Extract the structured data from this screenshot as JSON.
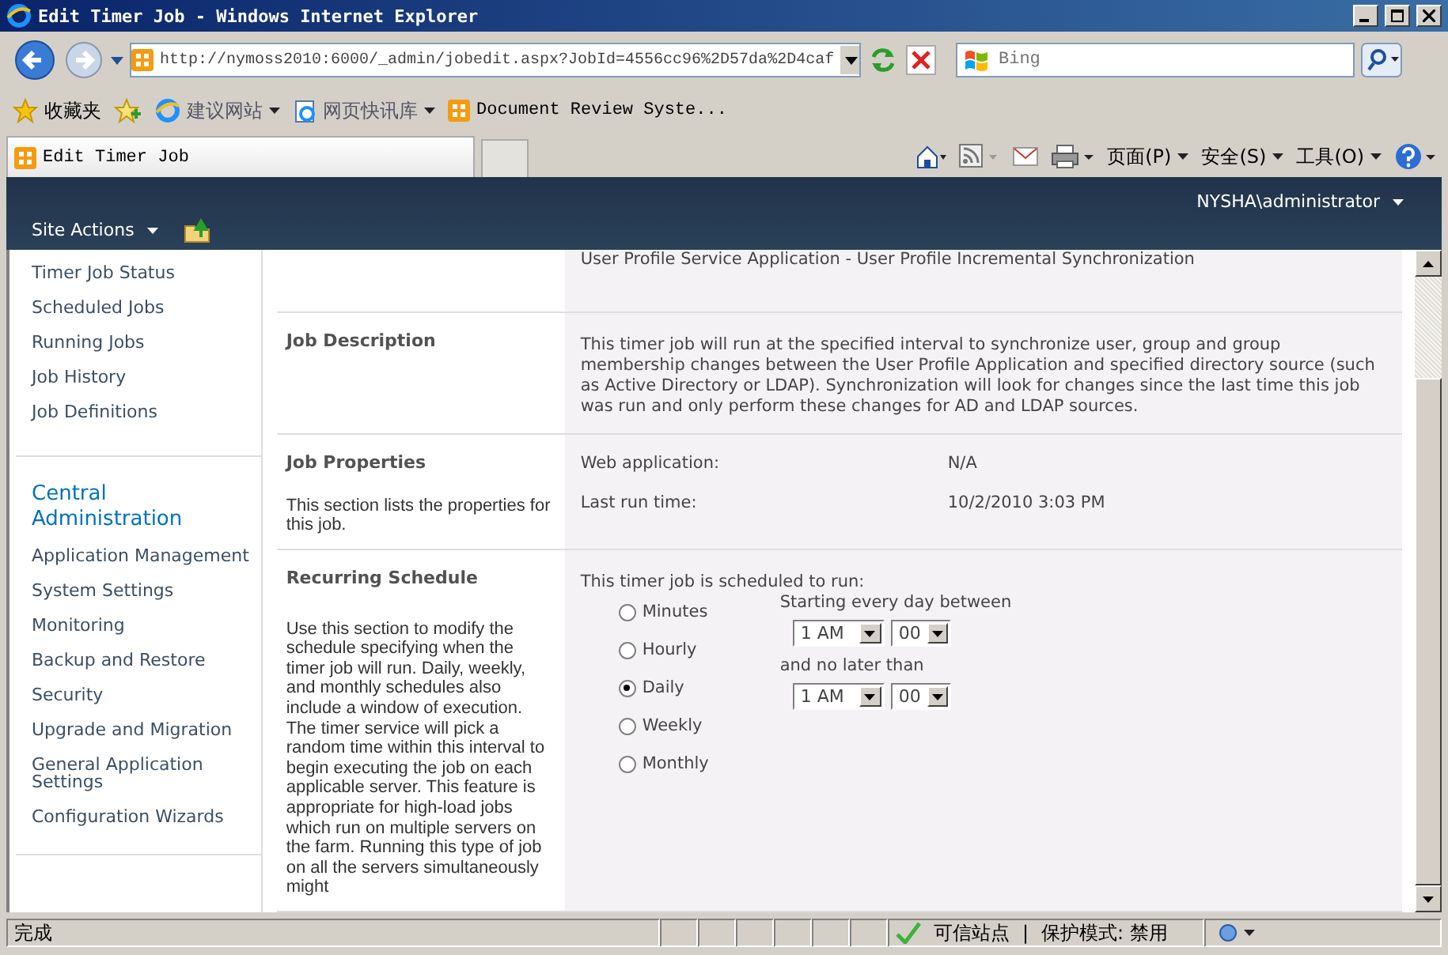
{
  "browser": {
    "title": "Edit Timer Job - Windows Internet Explorer",
    "address": "http://nymoss2010:6000/_admin/jobedit.aspx?JobId=4556cc96%2D57da%2D4caf",
    "search_placeholder": "Bing",
    "favorites_label": "收藏夹",
    "favorites": [
      {
        "label": "建议网站",
        "dropdown": true
      },
      {
        "label": "网页快讯库",
        "dropdown": true
      },
      {
        "label": "Document Review Syste...",
        "dropdown": false
      }
    ],
    "tabs": [
      {
        "label": "Edit Timer Job",
        "selected": true
      }
    ],
    "commands": [
      "页面(P)",
      "安全(S)",
      "工具(O)"
    ]
  },
  "site": {
    "site_actions": "Site Actions",
    "user": "NYSHA\\administrator"
  },
  "nav": {
    "items": [
      "Timer Job Status",
      "Scheduled Jobs",
      "Running Jobs",
      "Job History",
      "Job Definitions"
    ],
    "heading": "Central Administration",
    "admin_items": [
      "Application Management",
      "System Settings",
      "Monitoring",
      "Backup and Restore",
      "Security",
      "Upgrade and Migration",
      "General Application Settings",
      "Configuration Wizards"
    ]
  },
  "sections": [
    {
      "kind": "text",
      "text": "User Profile Service Application - User Profile Incremental Synchronization"
    },
    {
      "kind": "text",
      "title": "Job Description",
      "text": "This timer job will run at the specified interval to synchronize user, group and group membership changes between the User Profile Application and specified directory source (such as Active Directory or LDAP). Synchronization will look for changes since the last time this job was run and only perform these changes for AD and LDAP sources."
    },
    {
      "kind": "properties",
      "title": "Job Properties",
      "description": "This section lists the properties for this job.",
      "properties": [
        {
          "label": "Web application:",
          "value": "N/A"
        },
        {
          "label": "Last run time:",
          "value": "10/2/2010 3:03 PM"
        }
      ]
    },
    {
      "kind": "schedule",
      "title": "Recurring Schedule",
      "description": "Use this section to modify the schedule specifying when the timer job will run. Daily, weekly, and monthly schedules also include a window of execution. The timer service will pick a random time within this interval to begin executing the job on each applicable server. This feature is appropriate for high-load jobs which run on multiple servers on the farm. Running this type of job on all the servers simultaneously might",
      "intro": "This timer job is scheduled to run:",
      "options": [
        {
          "label": "Minutes",
          "selected": false
        },
        {
          "label": "Hourly",
          "selected": false
        },
        {
          "label": "Daily",
          "selected": true
        },
        {
          "label": "Weekly",
          "selected": false
        },
        {
          "label": "Monthly",
          "selected": false
        }
      ],
      "start_label": "Starting every day between",
      "start": {
        "hour": "1 AM",
        "minute": "00"
      },
      "end_label": "and no later than",
      "end": {
        "hour": "1 AM",
        "minute": "00"
      }
    }
  ],
  "status_bar": {
    "text": "完成",
    "zone": "可信站点",
    "separator": "|",
    "protected_mode": "保护模式: 禁用"
  }
}
